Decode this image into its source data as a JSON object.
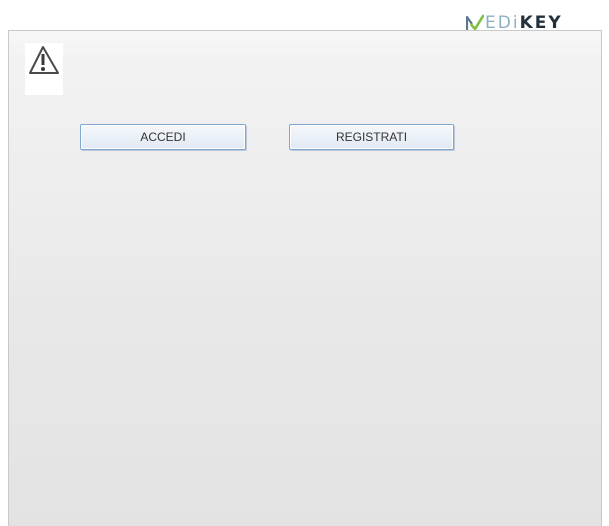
{
  "brand": {
    "logo_first": "M",
    "logo_mid": "EDi",
    "logo_end": "KEY",
    "colors": {
      "check_green": "#7ec043",
      "mid_blue": "#8fb0c4",
      "dark": "#23313c"
    }
  },
  "icons": {
    "warning": "warning-triangle-icon"
  },
  "actions": {
    "login_label": "ACCEDI",
    "register_label": "REGISTRATI"
  },
  "colors": {
    "button_border": "#7ea6cf",
    "panel_border": "#c9c9c9"
  }
}
